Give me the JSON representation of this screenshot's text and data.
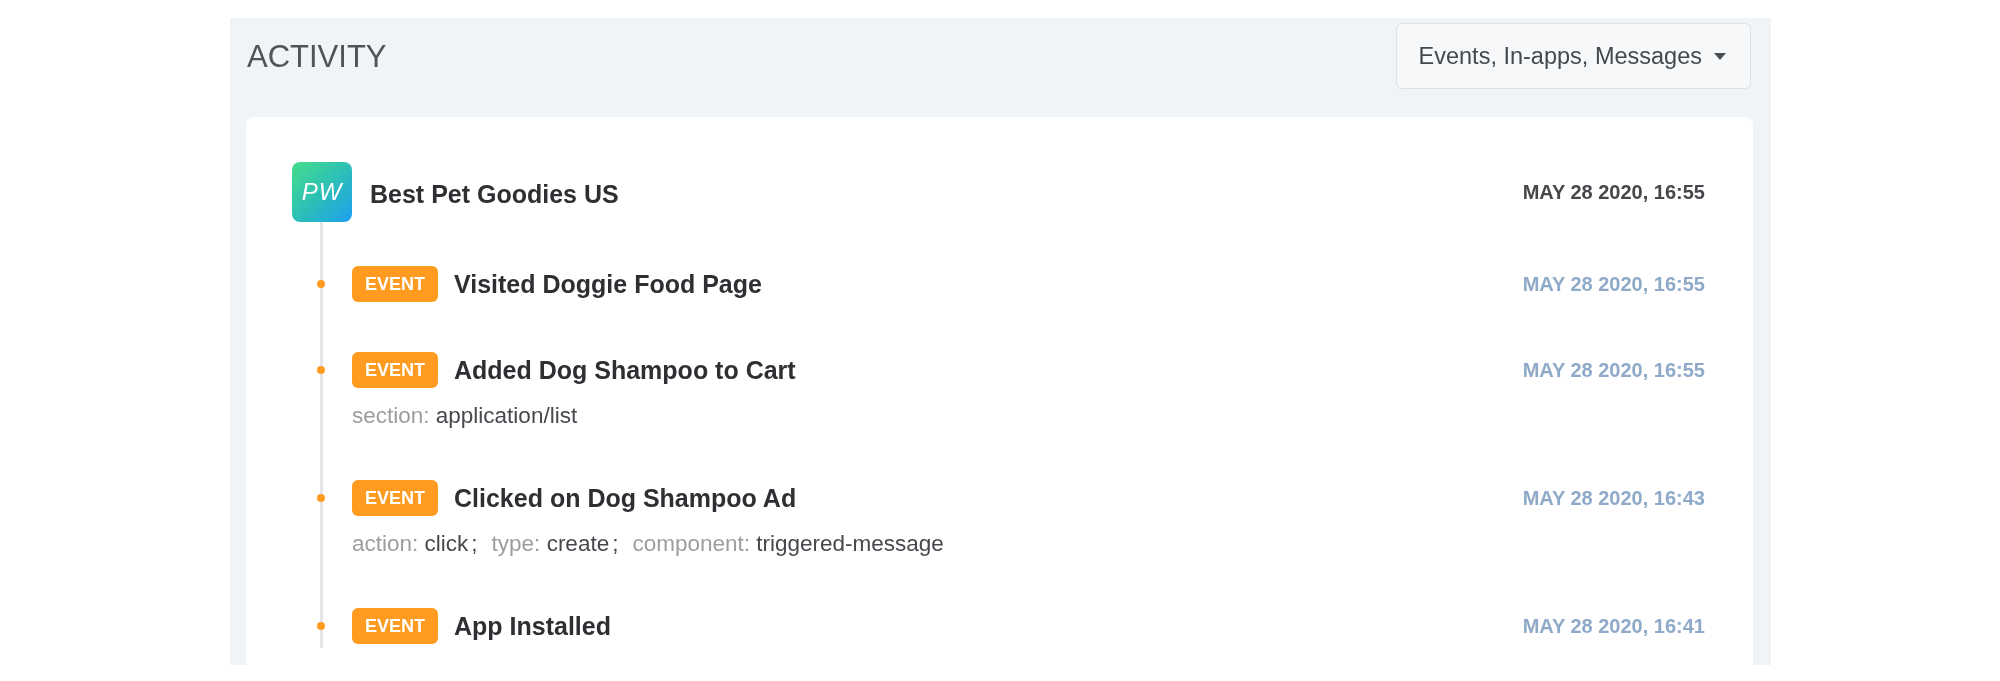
{
  "panel": {
    "title": "ACTIVITY",
    "filter_button": {
      "label": "Events, In-apps, Messages"
    }
  },
  "app": {
    "logo_text": "PW",
    "name": "Best Pet Goodies US",
    "time": "MAY 28 2020, 16:55"
  },
  "events": [
    {
      "badge": "EVENT",
      "title": "Visited Doggie Food Page",
      "time": "MAY 28 2020, 16:55"
    },
    {
      "badge": "EVENT",
      "title": "Added Dog Shampoo to Cart",
      "time": "MAY 28 2020, 16:55",
      "attributes": [
        {
          "key": "section:",
          "value": "application/list"
        }
      ]
    },
    {
      "badge": "EVENT",
      "title": "Clicked on Dog Shampoo Ad",
      "time": "MAY 28 2020, 16:43",
      "attributes": [
        {
          "key": "action:",
          "value": "click",
          "separator": ";"
        },
        {
          "key": "type:",
          "value": "create",
          "separator": ";"
        },
        {
          "key": "component:",
          "value": "triggered-message"
        }
      ]
    },
    {
      "badge": "EVENT",
      "title": "App Installed",
      "time": "MAY 28 2020, 16:41"
    }
  ]
}
